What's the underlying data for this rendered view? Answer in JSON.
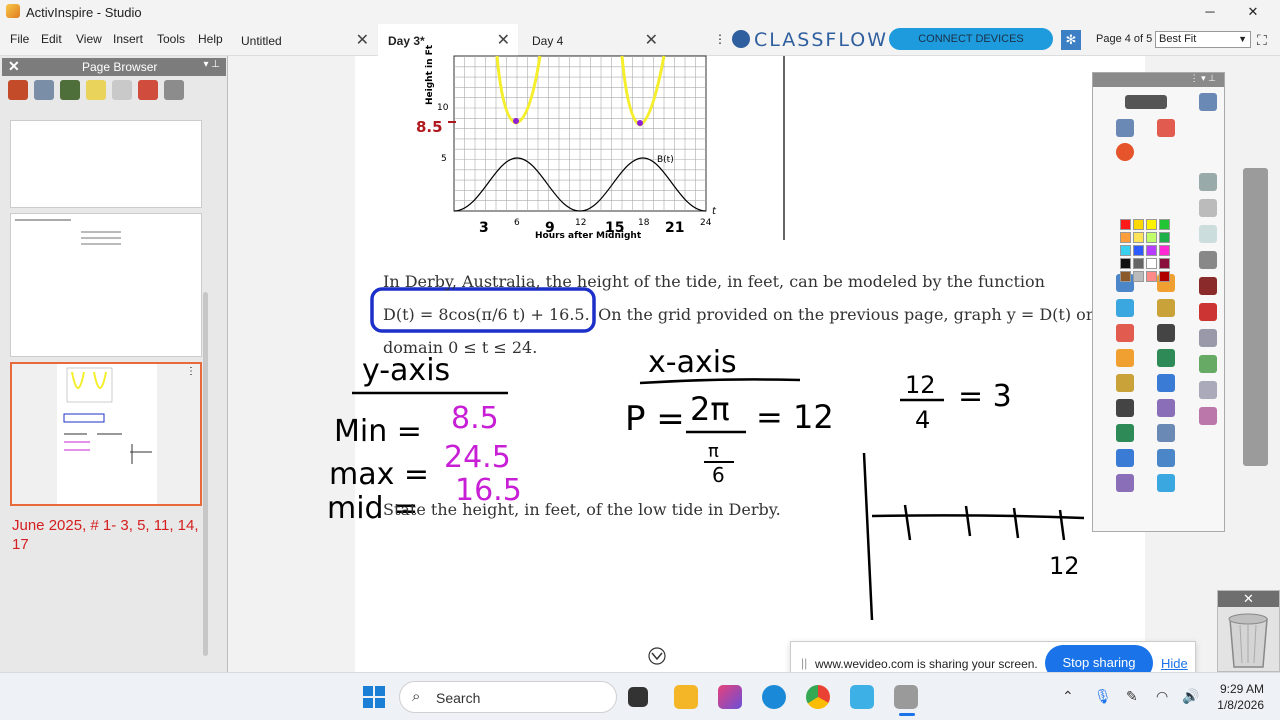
{
  "window": {
    "title": "ActivInspire - Studio",
    "min": "─",
    "max": "▢",
    "close": "✕"
  },
  "menu": [
    "File",
    "Edit",
    "View",
    "Insert",
    "Tools",
    "Help"
  ],
  "tabs": [
    {
      "label": "Untitled",
      "active": false
    },
    {
      "label": "Day 3*",
      "active": true
    },
    {
      "label": "Day 4",
      "active": false
    }
  ],
  "tabs_more": "⋮",
  "classflow": {
    "logo_text": "CLASSFLOW",
    "connect_label": "CONNECT DEVICES"
  },
  "page_nav": {
    "page_info": "Page 4 of 5",
    "zoom": "Best Fit"
  },
  "page_browser": {
    "title": "Page Browser",
    "close": "✕",
    "pin": "▾ ⊥",
    "note": "June 2025, # 1- 3, 5, 11, 14, 17"
  },
  "graph": {
    "y_axis_title": "Height in Ft",
    "x_axis_title": "Hours after Midnight",
    "curve_label": "B(t)",
    "y_ticks": [
      "10",
      "5"
    ],
    "x_ticks": [
      "6",
      "12",
      "18",
      "24"
    ],
    "x_var": "t",
    "annot_y": "8.5",
    "annot_x": [
      "3",
      "9",
      "15",
      "21"
    ]
  },
  "problem": {
    "line1": "In Derby, Australia, the height of the tide, in feet, can be modeled by the function",
    "func": "D(t) = 8cos(π/6 t) + 16.5.",
    "line2": "On the grid provided on the previous page, graph y = D(t) on the",
    "line3": "domain 0 ≤ t ≤ 24.",
    "question": "State the height, in feet, of the low tide in Derby."
  },
  "handwriting": {
    "y_title": "y-axis",
    "min_label": "Min =",
    "min_val": "8.5",
    "max_label": "max =",
    "max_val": "24.5",
    "mid_label": "mid =",
    "mid_val": "16.5",
    "x_title": "x-axis",
    "period_label": "P =",
    "period_num": "2π",
    "period_den_num": "π",
    "period_den_den": "6",
    "period_result": "= 12",
    "frac_num": "12",
    "frac_den": "4",
    "frac_result": "= 3",
    "axis_label": "12"
  },
  "share": {
    "message": "www.wevideo.com is sharing your screen.",
    "stop_label": "Stop sharing",
    "hide_label": "Hide"
  },
  "taskbar": {
    "search_placeholder": "Search",
    "time": "9:29 AM",
    "date": "1/8/2026"
  },
  "colors": {
    "accent": "#1e9bdc",
    "ink_magenta": "#c81fd6",
    "ink_blue": "#1d2fc9",
    "ink_yellow": "#f5ee2a",
    "ink_red": "#b0181e",
    "note_red": "#d42020"
  }
}
